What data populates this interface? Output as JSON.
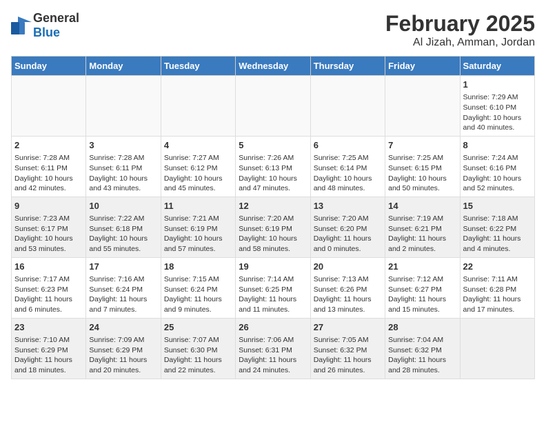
{
  "header": {
    "logo_general": "General",
    "logo_blue": "Blue",
    "month": "February 2025",
    "location": "Al Jizah, Amman, Jordan"
  },
  "days_of_week": [
    "Sunday",
    "Monday",
    "Tuesday",
    "Wednesday",
    "Thursday",
    "Friday",
    "Saturday"
  ],
  "weeks": [
    {
      "shaded": false,
      "days": [
        {
          "num": "",
          "info": ""
        },
        {
          "num": "",
          "info": ""
        },
        {
          "num": "",
          "info": ""
        },
        {
          "num": "",
          "info": ""
        },
        {
          "num": "",
          "info": ""
        },
        {
          "num": "",
          "info": ""
        },
        {
          "num": "1",
          "info": "Sunrise: 7:29 AM\nSunset: 6:10 PM\nDaylight: 10 hours\nand 40 minutes."
        }
      ]
    },
    {
      "shaded": false,
      "days": [
        {
          "num": "2",
          "info": "Sunrise: 7:28 AM\nSunset: 6:11 PM\nDaylight: 10 hours\nand 42 minutes."
        },
        {
          "num": "3",
          "info": "Sunrise: 7:28 AM\nSunset: 6:11 PM\nDaylight: 10 hours\nand 43 minutes."
        },
        {
          "num": "4",
          "info": "Sunrise: 7:27 AM\nSunset: 6:12 PM\nDaylight: 10 hours\nand 45 minutes."
        },
        {
          "num": "5",
          "info": "Sunrise: 7:26 AM\nSunset: 6:13 PM\nDaylight: 10 hours\nand 47 minutes."
        },
        {
          "num": "6",
          "info": "Sunrise: 7:25 AM\nSunset: 6:14 PM\nDaylight: 10 hours\nand 48 minutes."
        },
        {
          "num": "7",
          "info": "Sunrise: 7:25 AM\nSunset: 6:15 PM\nDaylight: 10 hours\nand 50 minutes."
        },
        {
          "num": "8",
          "info": "Sunrise: 7:24 AM\nSunset: 6:16 PM\nDaylight: 10 hours\nand 52 minutes."
        }
      ]
    },
    {
      "shaded": true,
      "days": [
        {
          "num": "9",
          "info": "Sunrise: 7:23 AM\nSunset: 6:17 PM\nDaylight: 10 hours\nand 53 minutes."
        },
        {
          "num": "10",
          "info": "Sunrise: 7:22 AM\nSunset: 6:18 PM\nDaylight: 10 hours\nand 55 minutes."
        },
        {
          "num": "11",
          "info": "Sunrise: 7:21 AM\nSunset: 6:19 PM\nDaylight: 10 hours\nand 57 minutes."
        },
        {
          "num": "12",
          "info": "Sunrise: 7:20 AM\nSunset: 6:19 PM\nDaylight: 10 hours\nand 58 minutes."
        },
        {
          "num": "13",
          "info": "Sunrise: 7:20 AM\nSunset: 6:20 PM\nDaylight: 11 hours\nand 0 minutes."
        },
        {
          "num": "14",
          "info": "Sunrise: 7:19 AM\nSunset: 6:21 PM\nDaylight: 11 hours\nand 2 minutes."
        },
        {
          "num": "15",
          "info": "Sunrise: 7:18 AM\nSunset: 6:22 PM\nDaylight: 11 hours\nand 4 minutes."
        }
      ]
    },
    {
      "shaded": false,
      "days": [
        {
          "num": "16",
          "info": "Sunrise: 7:17 AM\nSunset: 6:23 PM\nDaylight: 11 hours\nand 6 minutes."
        },
        {
          "num": "17",
          "info": "Sunrise: 7:16 AM\nSunset: 6:24 PM\nDaylight: 11 hours\nand 7 minutes."
        },
        {
          "num": "18",
          "info": "Sunrise: 7:15 AM\nSunset: 6:24 PM\nDaylight: 11 hours\nand 9 minutes."
        },
        {
          "num": "19",
          "info": "Sunrise: 7:14 AM\nSunset: 6:25 PM\nDaylight: 11 hours\nand 11 minutes."
        },
        {
          "num": "20",
          "info": "Sunrise: 7:13 AM\nSunset: 6:26 PM\nDaylight: 11 hours\nand 13 minutes."
        },
        {
          "num": "21",
          "info": "Sunrise: 7:12 AM\nSunset: 6:27 PM\nDaylight: 11 hours\nand 15 minutes."
        },
        {
          "num": "22",
          "info": "Sunrise: 7:11 AM\nSunset: 6:28 PM\nDaylight: 11 hours\nand 17 minutes."
        }
      ]
    },
    {
      "shaded": true,
      "days": [
        {
          "num": "23",
          "info": "Sunrise: 7:10 AM\nSunset: 6:29 PM\nDaylight: 11 hours\nand 18 minutes."
        },
        {
          "num": "24",
          "info": "Sunrise: 7:09 AM\nSunset: 6:29 PM\nDaylight: 11 hours\nand 20 minutes."
        },
        {
          "num": "25",
          "info": "Sunrise: 7:07 AM\nSunset: 6:30 PM\nDaylight: 11 hours\nand 22 minutes."
        },
        {
          "num": "26",
          "info": "Sunrise: 7:06 AM\nSunset: 6:31 PM\nDaylight: 11 hours\nand 24 minutes."
        },
        {
          "num": "27",
          "info": "Sunrise: 7:05 AM\nSunset: 6:32 PM\nDaylight: 11 hours\nand 26 minutes."
        },
        {
          "num": "28",
          "info": "Sunrise: 7:04 AM\nSunset: 6:32 PM\nDaylight: 11 hours\nand 28 minutes."
        },
        {
          "num": "",
          "info": ""
        }
      ]
    }
  ]
}
